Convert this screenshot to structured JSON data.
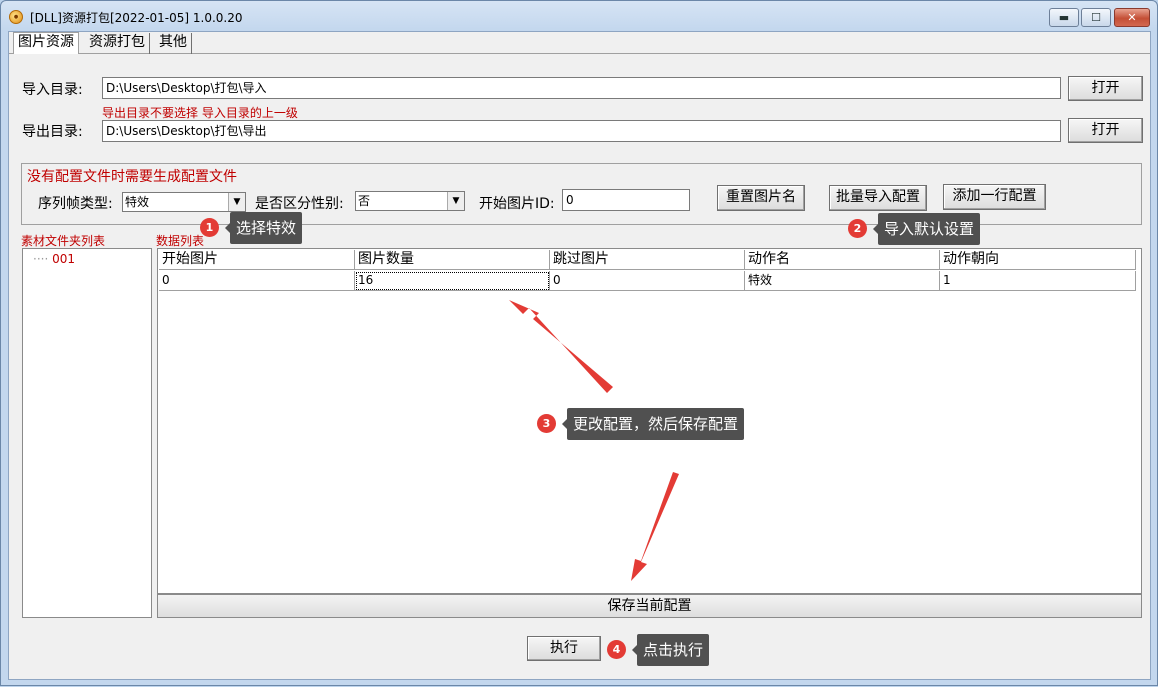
{
  "window": {
    "title": "[DLL]资源打包[2022-01-05] 1.0.0.20",
    "icon": "app-logo-icon",
    "controls": {
      "minimize": "▬",
      "maximize": "☐",
      "close": "✕"
    }
  },
  "tabs": [
    {
      "label": "图片资源",
      "active": true
    },
    {
      "label": "资源打包",
      "active": false
    },
    {
      "label": "其他",
      "active": false
    }
  ],
  "import": {
    "label": "导入目录:",
    "value": "D:\\Users\\Desktop\\打包\\导入",
    "button": "打开"
  },
  "hint": "导出目录不要选择 导入目录的上一级",
  "export": {
    "label": "导出目录:",
    "value": "D:\\Users\\Desktop\\打包\\导出",
    "button": "打开"
  },
  "config": {
    "title": "没有配置文件时需要生成配置文件",
    "frame_type_label": "序列帧类型:",
    "frame_type_value": "特效",
    "gender_label": "是否区分性别:",
    "gender_value": "否",
    "start_id_label": "开始图片ID:",
    "start_id_value": "0",
    "reset_names_button": "重置图片名",
    "batch_import_button": "批量导入配置",
    "add_row_button": "添加一行配置"
  },
  "folder_list": {
    "title": "素材文件夹列表",
    "items": [
      "001"
    ]
  },
  "data_list": {
    "title": "数据列表",
    "columns": [
      "开始图片",
      "图片数量",
      "跳过图片",
      "动作名",
      "动作朝向"
    ],
    "rows": [
      [
        "0",
        "16",
        "0",
        "特效",
        "1"
      ]
    ]
  },
  "save_button": "保存当前配置",
  "execute_button": "执行",
  "annotations": [
    {
      "num": "1",
      "text": "选择特效"
    },
    {
      "num": "2",
      "text": "导入默认设置"
    },
    {
      "num": "3",
      "text": "更改配置，然后保存配置"
    },
    {
      "num": "4",
      "text": "点击执行"
    }
  ],
  "colors": {
    "annotation_red": "#e33b35",
    "callout_bg": "#505050",
    "label_red": "#c00000"
  }
}
